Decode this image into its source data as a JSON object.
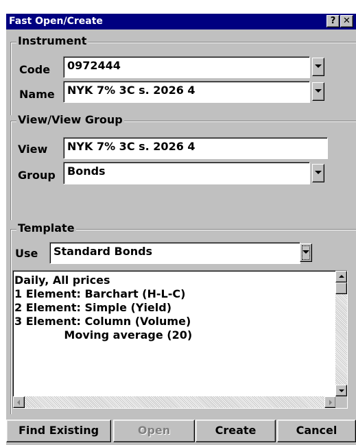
{
  "window": {
    "title": "Fast Open/Create",
    "help_glyph": "?",
    "close_glyph": "✕"
  },
  "instrument": {
    "group_label": "Instrument",
    "code_label": "Code",
    "code_value": "0972444",
    "name_label": "Name",
    "name_value": "NYK 7% 3C s. 2026 4"
  },
  "view_group": {
    "group_label": "View/View Group",
    "view_label": "View",
    "view_value": "NYK 7% 3C s. 2026 4",
    "group_field_label": "Group",
    "group_value": "Bonds"
  },
  "template": {
    "group_label": "Template",
    "use_label": "Use",
    "use_value": "Standard Bonds",
    "description_lines": [
      "Daily, All prices",
      "1 Element: Barchart (H-L-C)",
      "2 Element: Simple (Yield)",
      "3 Element: Column (Volume)",
      "             Moving average (20)"
    ]
  },
  "buttons": {
    "find_existing": "Find Existing",
    "open": "Open",
    "create": "Create",
    "cancel": "Cancel"
  },
  "colors": {
    "titlebar": "#000080",
    "face": "#c0c0c0",
    "field": "#ffffff",
    "disabled_text": "#808080"
  }
}
